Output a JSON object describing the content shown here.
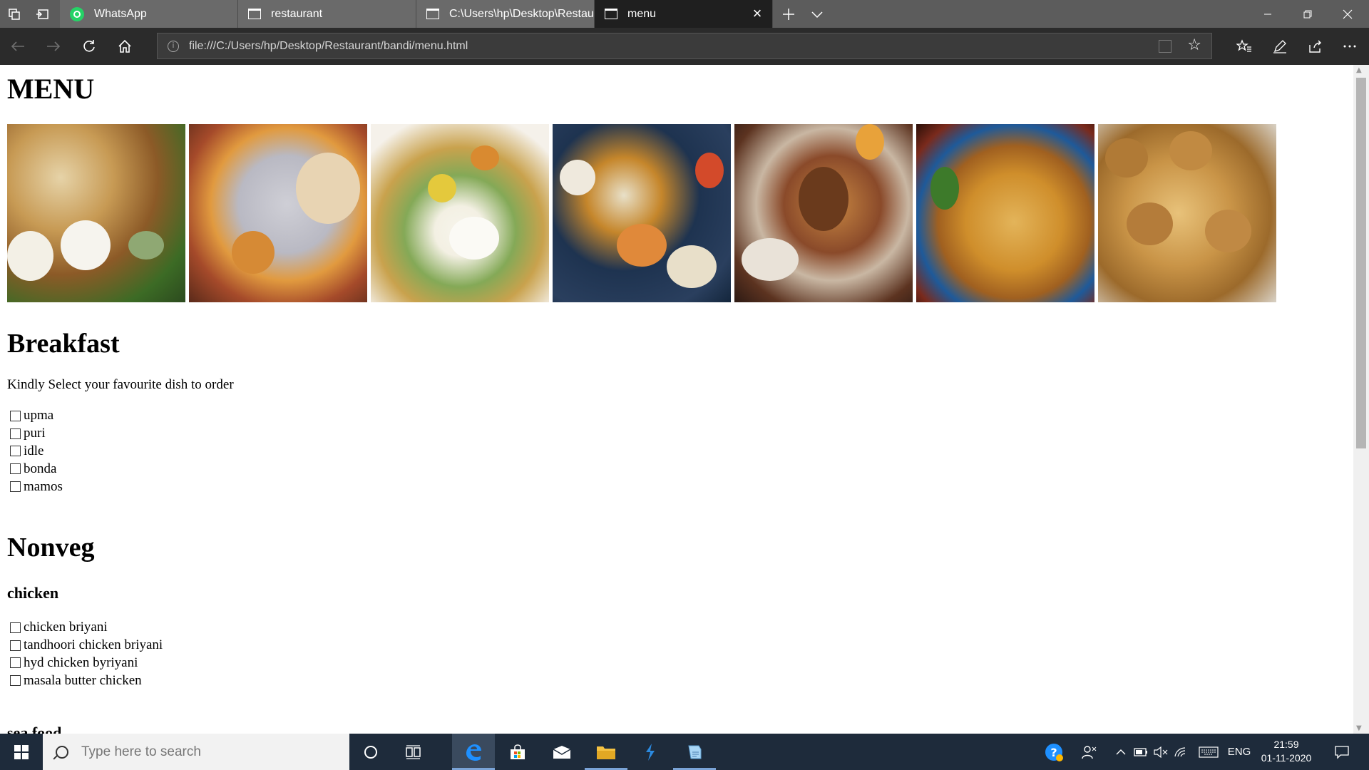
{
  "browser": {
    "tabs": [
      {
        "label": "WhatsApp"
      },
      {
        "label": "restaurant"
      },
      {
        "label": "C:\\Users\\hp\\Desktop\\Restau"
      },
      {
        "label": "menu"
      }
    ],
    "url": "file:///C:/Users/hp/Desktop/Restaurant/bandi/menu.html"
  },
  "page": {
    "title": "MENU",
    "breakfast": {
      "heading": "Breakfast",
      "prompt": "Kindly Select your favourite dish to order",
      "items": [
        "upma",
        "puri",
        "idle",
        "bonda",
        "mamos"
      ]
    },
    "nonveg": {
      "heading": "Nonveg",
      "subheading": "chicken",
      "items": [
        "chicken briyani",
        "tandhoori chicken briyani",
        "hyd chicken byriyani",
        "masala butter chicken"
      ],
      "next_subheading": "sea food"
    }
  },
  "taskbar": {
    "search_placeholder": "Type here to search",
    "language": "ENG",
    "time": "21:59",
    "date": "01-11-2020"
  }
}
